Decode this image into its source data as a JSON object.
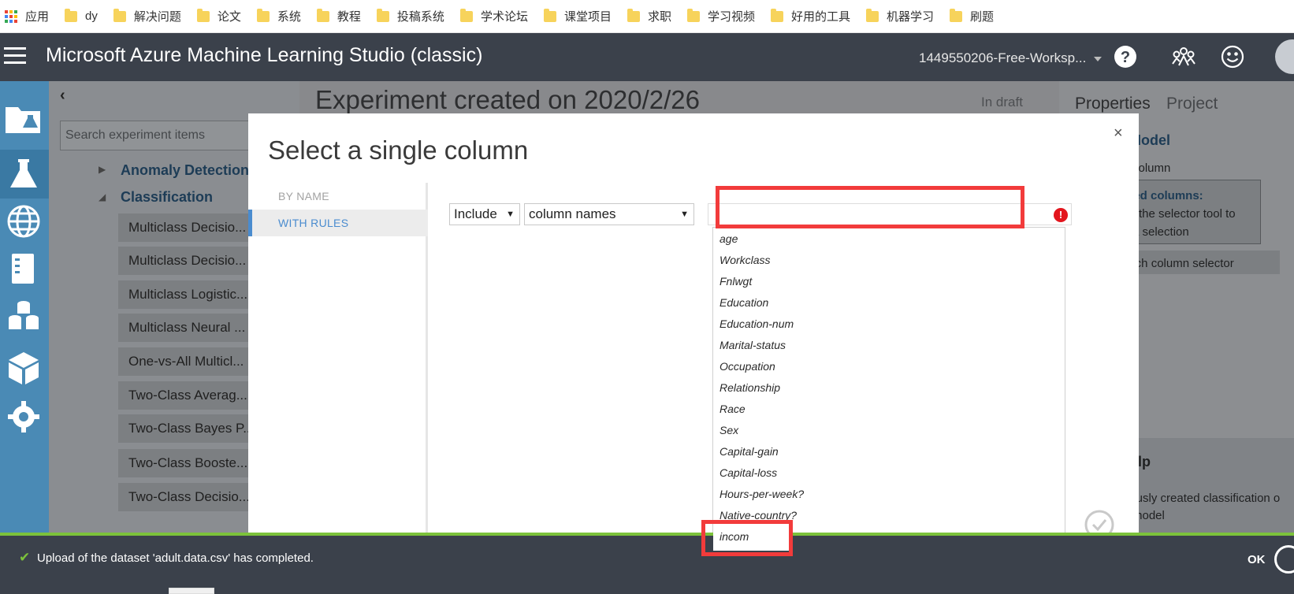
{
  "bookmarks": {
    "apps_label": "应用",
    "folders": [
      "dy",
      "解决问题",
      "论文",
      "系统",
      "教程",
      "投稿系统",
      "学术论坛",
      "课堂项目",
      "求职",
      "学习视频",
      "好用的工具",
      "机器学习",
      "刷题"
    ]
  },
  "header": {
    "title": "Microsoft Azure Machine Learning Studio (classic)",
    "workspace": "1449550206-Free-Worksp..."
  },
  "palette": {
    "search_placeholder": "Search experiment items",
    "categories": [
      "Anomaly Detection",
      "Classification"
    ],
    "modules": [
      "Multiclass Decisio...",
      "Multiclass Decisio...",
      "Multiclass Logistic...",
      "Multiclass Neural ...",
      "One-vs-All Multicl...",
      "Two-Class Averag...",
      "Two-Class Bayes P...",
      "Two-Class Booste...",
      "Two-Class Decisio..."
    ]
  },
  "experiment": {
    "title": "Experiment created on 2020/2/26",
    "status": "In draft"
  },
  "properties": {
    "tabs": [
      "Properties",
      "Project"
    ],
    "heading": "Model",
    "label": "column",
    "selected_title": "cted columns:",
    "hint_line1": "ch the selector tool to",
    "hint_line2": "a selection",
    "launch_button": "unch column selector",
    "help_heading": "elp",
    "help_line1": "iously created classification o",
    "help_line2": "model"
  },
  "modal": {
    "title": "Select a single column",
    "close": "×",
    "tab_by_name": "BY NAME",
    "tab_with_rules": "WITH RULES",
    "include_value": "Include",
    "type_value": "column names",
    "error_icon": "!",
    "columns": [
      "age",
      "Workclass",
      "Fnlwgt",
      "Education",
      "Education-num",
      "Marital-status",
      "Occupation",
      "Relationship",
      "Race",
      "Sex",
      "Capital-gain",
      "Capital-loss",
      "Hours-per-week?",
      "Native-country?",
      "incom"
    ]
  },
  "status": {
    "message": "Upload of the dataset 'adult.data.csv' has completed.",
    "ok": "OK"
  },
  "colors": {
    "header_bg": "#3b414b",
    "nav_bg": "#4a8ab5",
    "accent_blue": "#4a8ccf",
    "highlight_red": "#f23b3b",
    "success_green": "#7cc23b"
  }
}
